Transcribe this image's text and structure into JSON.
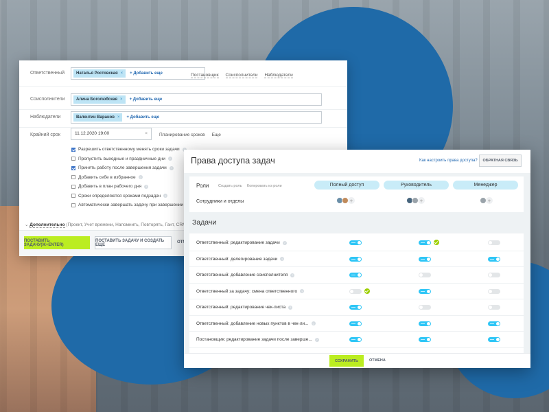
{
  "task_form": {
    "responsible": {
      "label": "Ответственный",
      "chip": "Наталья Ростовская",
      "add": "+ Добавить еще",
      "links": [
        "Постановщик",
        "Соисполнители",
        "Наблюдатели"
      ]
    },
    "co_executors": {
      "label": "Соисполнители",
      "chip": "Алина Боголюбская",
      "add": "+ Добавить еще"
    },
    "observers": {
      "label": "Наблюдатели",
      "chip": "Валентин Варанов",
      "add": "+ Добавить еще"
    },
    "deadline": {
      "label": "Крайний срок",
      "value": "11.12.2020 19:00",
      "links": [
        "Планирование сроков",
        "Еще"
      ]
    },
    "checkboxes": [
      {
        "label": "Разрешить ответственному менять сроки задачи",
        "checked": true
      },
      {
        "label": "Пропустить выходные и праздничные дни",
        "checked": false
      },
      {
        "label": "Принять работу после завершения задачи",
        "checked": true
      },
      {
        "label": "Добавить себе в избранное",
        "checked": false
      },
      {
        "label": "Добавить в план рабочего дня",
        "checked": false
      },
      {
        "label": "Сроки определяются сроками подзадач",
        "checked": false
      },
      {
        "label": "Автоматически завершать задачу при завершении под",
        "checked": false
      }
    ],
    "additional": {
      "title": "Дополнительно",
      "items": "(Проект, Учет времени, Напомнить, Повторять, Гант, CRM"
    },
    "buttons": {
      "submit": "ПОСТАВИТЬ ЗАДАЧУ(Ж+ENTER)",
      "submit_more": "ПОСТАВИТЬ ЗАДАЧУ И СОЗДАТЬ ЕЩЕ",
      "cut": "ОТМ"
    }
  },
  "rights_panel": {
    "title": "Права доступа задач",
    "help_link": "Как настроить права доступа?",
    "feedback_button": "ОБРАТНАЯ СВЯЗЬ",
    "roles_label": "Роли",
    "create_role": "Создать роль",
    "copy_from": "Копировать из роли",
    "roles": [
      "Полный доступ",
      "Руководитель",
      "Менеджер"
    ],
    "employees_label": "Сотрудники и отделы",
    "tasks_title": "Задачи",
    "rows": [
      {
        "label": "Ответственный: редактирование задачи",
        "toggles": [
          true,
          true,
          false
        ],
        "changed": [
          false,
          true,
          false
        ]
      },
      {
        "label": "Ответственный: делегирование задачи",
        "toggles": [
          true,
          true,
          true
        ],
        "changed": [
          false,
          false,
          false
        ]
      },
      {
        "label": "Ответственный: добавление соисполнителя",
        "toggles": [
          true,
          false,
          false
        ],
        "changed": [
          false,
          false,
          false
        ]
      },
      {
        "label": "Ответственный за задачу: смена ответственного",
        "toggles": [
          false,
          true,
          false
        ],
        "changed": [
          true,
          false,
          false
        ]
      },
      {
        "label": "Ответственный: редактирование чек-листа",
        "toggles": [
          true,
          false,
          false
        ],
        "changed": [
          false,
          false,
          false
        ]
      },
      {
        "label": "Ответственный: добавление новых пунктов в чек-ли...",
        "toggles": [
          true,
          true,
          true
        ],
        "changed": [
          false,
          false,
          false
        ]
      },
      {
        "label": "Постановщик: редактирование задачи после заверше...",
        "toggles": [
          true,
          true,
          true
        ],
        "changed": [
          false,
          false,
          false
        ]
      }
    ],
    "save_button": "СОХРАНИТЬ",
    "cancel_button": "ОТМЕНА",
    "colors": {
      "accent_green": "#bbed21",
      "toggle_on": "#2fc6f6",
      "role_pill": "#c9ecf8",
      "brand_blue": "#1f6aa8"
    }
  }
}
